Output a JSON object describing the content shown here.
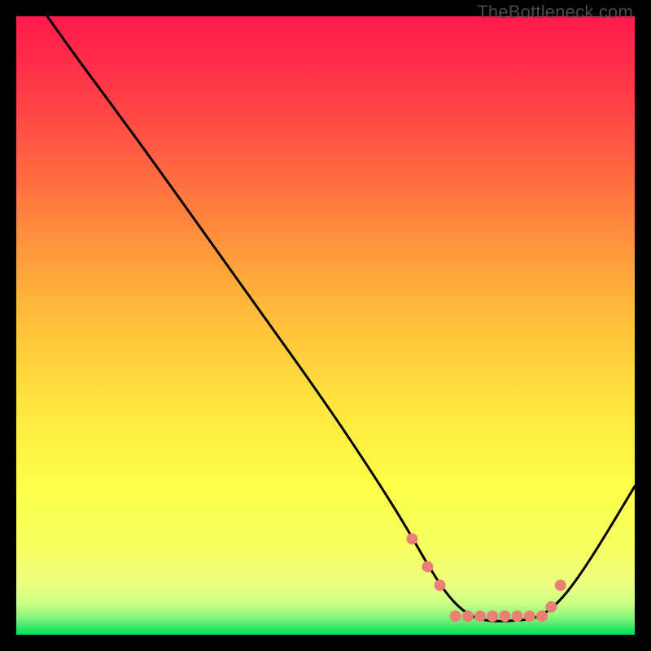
{
  "watermark": "TheBottleneck.com",
  "chart_data": {
    "type": "line",
    "title": "",
    "xlabel": "",
    "ylabel": "",
    "xlim": [
      0,
      100
    ],
    "ylim": [
      0,
      100
    ],
    "grid": false,
    "legend": false,
    "background_gradient": {
      "top_color": "#ff1a4b",
      "mid_colors": [
        "#ff6a3c",
        "#ffb43a",
        "#ffe23c",
        "#fcff4a",
        "#f2ff72"
      ],
      "bottom_color": "#00e05a"
    },
    "curve": {
      "description": "Black bottleneck-style curve, steeply descending from top-left, reaching a flat minimum around x≈78, rising back up toward right edge",
      "points": [
        {
          "x": 5.0,
          "y": 100.0
        },
        {
          "x": 10.0,
          "y": 93.0
        },
        {
          "x": 20.0,
          "y": 79.5
        },
        {
          "x": 30.0,
          "y": 65.5
        },
        {
          "x": 40.0,
          "y": 51.5
        },
        {
          "x": 50.0,
          "y": 37.5
        },
        {
          "x": 58.0,
          "y": 25.5
        },
        {
          "x": 63.0,
          "y": 17.5
        },
        {
          "x": 67.0,
          "y": 10.5
        },
        {
          "x": 70.0,
          "y": 6.0
        },
        {
          "x": 73.0,
          "y": 3.2
        },
        {
          "x": 76.0,
          "y": 2.2
        },
        {
          "x": 80.0,
          "y": 2.2
        },
        {
          "x": 84.0,
          "y": 2.6
        },
        {
          "x": 87.0,
          "y": 4.5
        },
        {
          "x": 90.0,
          "y": 8.0
        },
        {
          "x": 94.0,
          "y": 14.0
        },
        {
          "x": 100.0,
          "y": 24.0
        }
      ]
    },
    "markers": {
      "color": "#e98073",
      "radius_px": 7,
      "points": [
        {
          "x": 64.0,
          "y": 15.5
        },
        {
          "x": 66.5,
          "y": 11.0
        },
        {
          "x": 68.5,
          "y": 8.0
        },
        {
          "x": 71.0,
          "y": 3.0
        },
        {
          "x": 73.0,
          "y": 3.0
        },
        {
          "x": 75.0,
          "y": 3.0
        },
        {
          "x": 77.0,
          "y": 3.0
        },
        {
          "x": 79.0,
          "y": 3.0
        },
        {
          "x": 81.0,
          "y": 3.0
        },
        {
          "x": 83.0,
          "y": 3.0
        },
        {
          "x": 85.0,
          "y": 3.0
        },
        {
          "x": 86.5,
          "y": 4.5
        },
        {
          "x": 88.0,
          "y": 8.0
        }
      ]
    }
  }
}
